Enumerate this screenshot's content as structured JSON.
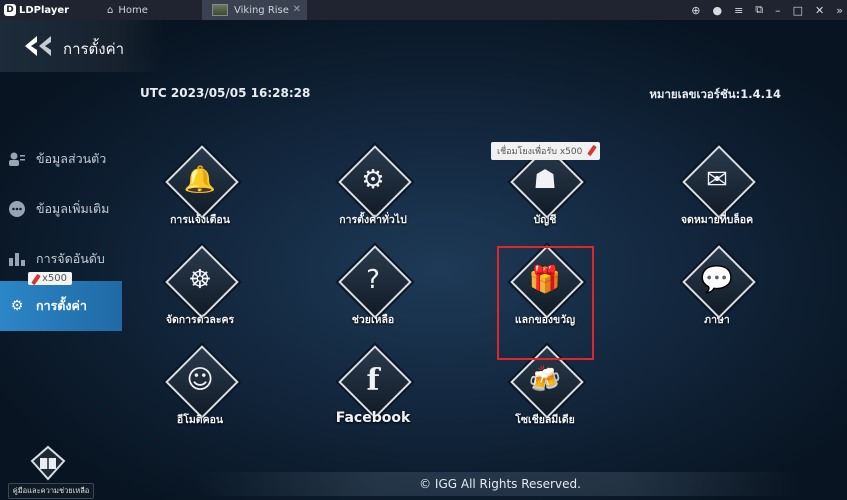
{
  "titlebar": {
    "app_name": "LDPlayer",
    "tabs": [
      {
        "label": "Home"
      },
      {
        "label": "Viking Rise"
      }
    ],
    "controls": [
      "gamepad-icon",
      "user-icon",
      "menu-icon",
      "restore-icon",
      "minimize-icon",
      "maximize-icon",
      "close-icon",
      "expand-icon"
    ]
  },
  "header": {
    "title": "การตั้งค่า"
  },
  "info": {
    "utc_time": "UTC 2023/05/05 16:28:28",
    "version": "หมายเลขเวอร์ชัน:1.4.14"
  },
  "sidebar": {
    "items": [
      {
        "label": "ข้อมูลส่วนตัว",
        "icon": "profile-icon"
      },
      {
        "label": "ข้อมูลเพิ่มเติม",
        "icon": "chat-icon"
      },
      {
        "label": "การจัดอันดับ",
        "icon": "ranking-icon"
      },
      {
        "label": "การตั้งค่า",
        "icon": "gear-icon",
        "active": true
      }
    ],
    "badge": "x500"
  },
  "grid": {
    "items": [
      {
        "label": "การแจ้งเตือน",
        "icon": "bell-icon"
      },
      {
        "label": "การตั้งค่าทั่วไป",
        "icon": "gears-icon"
      },
      {
        "label": "บัญชี",
        "icon": "account-icon"
      },
      {
        "label": "จดหมายที่บล็อค",
        "icon": "blocked-mail-icon"
      },
      {
        "label": "จัดการตัวละคร",
        "icon": "character-icon"
      },
      {
        "label": "ช่วยเหลือ",
        "icon": "help-book-icon"
      },
      {
        "label": "แลกของขวัญ",
        "icon": "gift-icon"
      },
      {
        "label": "ภาษา",
        "icon": "language-icon"
      },
      {
        "label": "อีโมติคอน",
        "icon": "emoticon-icon"
      },
      {
        "label": "Facebook",
        "icon": "facebook-icon"
      },
      {
        "label": "โซเชียลมีเดีย",
        "icon": "social-media-icon"
      }
    ],
    "link_badge": "เชื่อมโยงเพื่อรับ x500"
  },
  "help": {
    "label": "คู่มือและความช่วยเหลือ"
  },
  "footer": {
    "text": "© IGG All Rights Reserved."
  },
  "colors": {
    "active_tab": "#2c86c7",
    "highlight": "#e0252b",
    "badge_pencil": "#d13a2e"
  }
}
